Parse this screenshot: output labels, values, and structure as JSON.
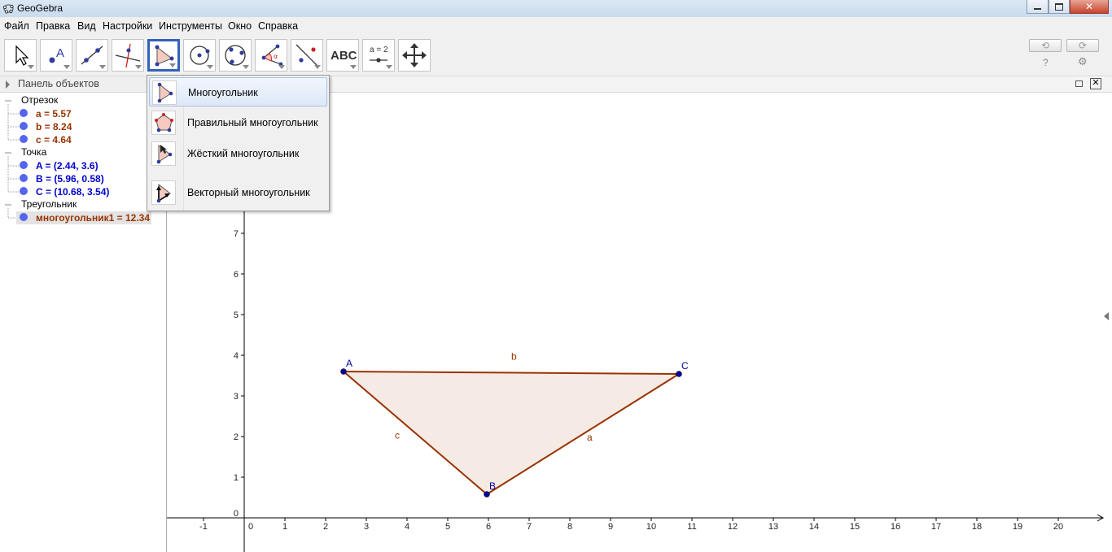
{
  "window": {
    "title": "GeoGebra"
  },
  "menubar": [
    "Файл",
    "Правка",
    "Вид",
    "Настройки",
    "Инструменты",
    "Окно",
    "Справка"
  ],
  "toolbar": {
    "tools": [
      "move",
      "point",
      "line",
      "perpendicular-line",
      "polygon",
      "circle",
      "circle-through-3-points",
      "angle",
      "reflect",
      "text",
      "slider",
      "move-graphics-view"
    ],
    "selected_tool": "polygon",
    "text_tool_label": "ABC",
    "slider_tool_label": "a = 2",
    "help_label": "?",
    "settings_label": "⚙"
  },
  "algebra": {
    "header": "Панель объектов",
    "categories": [
      {
        "label": "Отрезок",
        "items": [
          "a = 5.57",
          "b = 8.24",
          "c = 4.64"
        ],
        "color": "#993300"
      },
      {
        "label": "Точка",
        "items": [
          "A = (2.44, 3.6)",
          "B = (5.96, 0.58)",
          "C = (10.68, 3.54)"
        ],
        "color": "#0000cc"
      },
      {
        "label": "Треугольник",
        "items": [
          "многоугольник1 = 12.34"
        ],
        "color": "#993300"
      }
    ]
  },
  "tool_menu": {
    "items": [
      {
        "label": "Многоугольник"
      },
      {
        "label": "Правильный многоугольник"
      },
      {
        "label": "Жёсткий многоугольник"
      },
      {
        "label": "Векторный многоугольник"
      }
    ]
  },
  "graph": {
    "x_ticks": [
      -1,
      0,
      1,
      2,
      3,
      4,
      5,
      6,
      7,
      8,
      9,
      10,
      11,
      12,
      13,
      14,
      15,
      16,
      17,
      18,
      19,
      20
    ],
    "y_ticks": [
      0,
      1,
      2,
      3,
      4,
      5,
      6,
      7
    ],
    "points": [
      {
        "name": "A",
        "x": 2.44,
        "y": 3.6
      },
      {
        "name": "B",
        "x": 5.96,
        "y": 0.58
      },
      {
        "name": "C",
        "x": 10.68,
        "y": 3.54
      }
    ],
    "segments": [
      {
        "name": "a",
        "from": "B",
        "to": "C"
      },
      {
        "name": "b",
        "from": "A",
        "to": "C"
      },
      {
        "name": "c",
        "from": "A",
        "to": "B"
      }
    ],
    "polygon_color": "#993300",
    "point_color": "#0000a0",
    "fill_color": "#f4e6e1"
  }
}
